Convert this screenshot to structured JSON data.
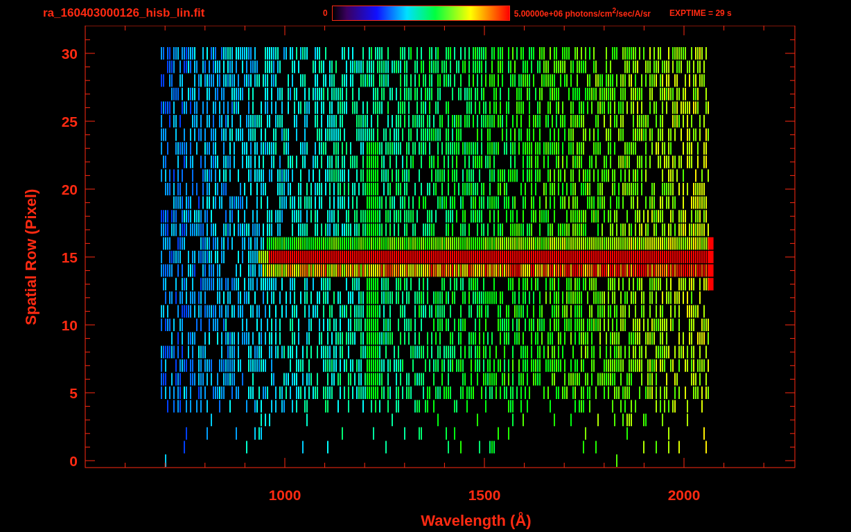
{
  "title": "ra_160403000126_hisb_lin.fit",
  "colorbar": {
    "min_label": "0",
    "max_label": "5.00000e+06 photons/cm$^{2}$/sec/A/sr"
  },
  "exposure": "EXPTIME = 29 s",
  "y_axis": {
    "label": "Spatial Row (Pixel)",
    "ticks": [
      "30",
      "25",
      "20",
      "15",
      "10",
      "5",
      "0"
    ]
  },
  "x_axis": {
    "label": "Wavelength (Å)",
    "ticks": [
      "1000",
      "1500",
      "2000"
    ]
  }
}
